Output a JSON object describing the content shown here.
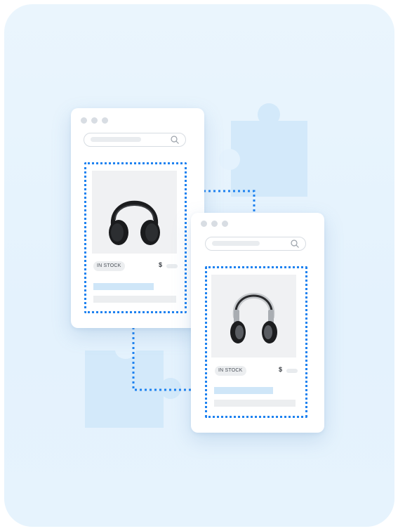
{
  "product_cards": [
    {
      "stock_label": "IN STOCK",
      "currency_symbol": "$",
      "image": "over-ear-headphones-black"
    },
    {
      "stock_label": "IN STOCK",
      "currency_symbol": "$",
      "image": "dj-headphones-silver"
    }
  ],
  "colors": {
    "background": "#e6f3fd",
    "highlight_dashed": "#1e82f0",
    "puzzle": "#d3e9fa"
  },
  "icons": [
    "search-icon",
    "puzzle-piece-icon",
    "headphones-icon"
  ]
}
